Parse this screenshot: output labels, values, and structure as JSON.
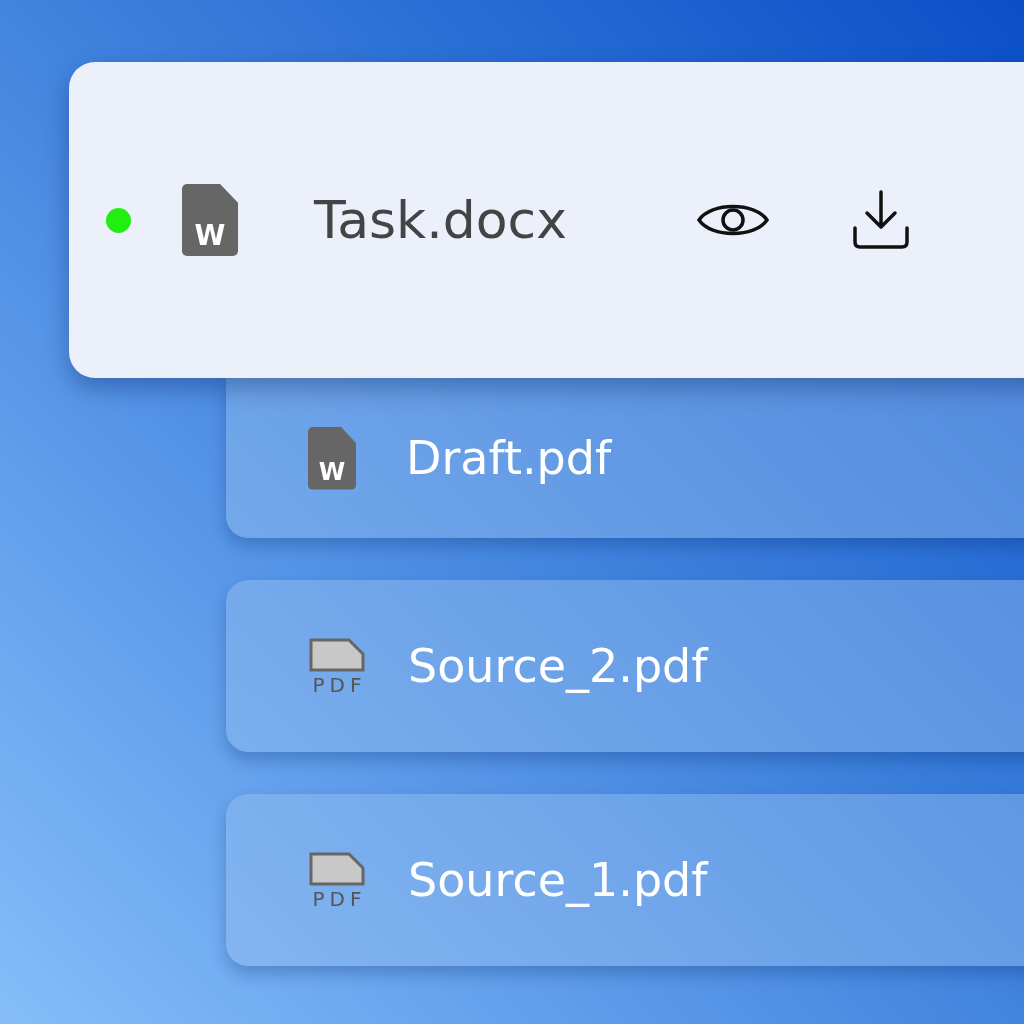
{
  "files": [
    {
      "name": "Task.docx",
      "kind": "word",
      "icon_text": "W",
      "active": true,
      "actions": [
        {
          "kind": "view"
        },
        {
          "kind": "download"
        }
      ]
    },
    {
      "name": "Draft.pdf",
      "kind": "word",
      "icon_text": "W",
      "active": false
    },
    {
      "name": "Source_2.pdf",
      "kind": "pdf",
      "icon_text": "PDF",
      "active": false
    },
    {
      "name": "Source_1.pdf",
      "kind": "pdf",
      "icon_text": "PDF",
      "active": false
    }
  ]
}
